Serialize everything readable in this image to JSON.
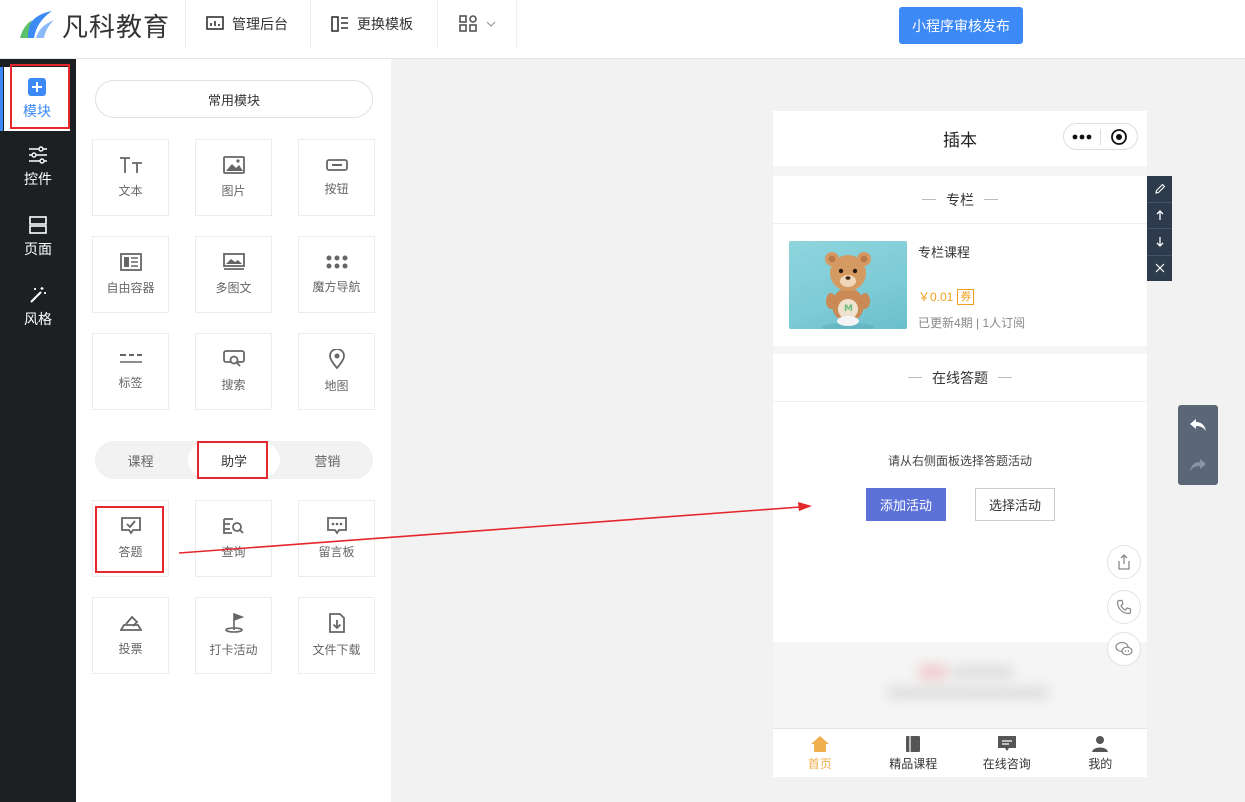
{
  "app": {
    "logo_text": "凡科教育",
    "nav": {
      "admin": "管理后台",
      "template": "更换模板"
    },
    "publish_button": "小程序审核发布"
  },
  "sidebar": {
    "items": [
      {
        "label": "模块",
        "icon": "plus-square-icon"
      },
      {
        "label": "控件",
        "icon": "sliders-icon"
      },
      {
        "label": "页面",
        "icon": "layout-icon"
      },
      {
        "label": "风格",
        "icon": "magic-wand-icon"
      }
    ]
  },
  "panel": {
    "common_title": "常用模块",
    "common_modules": [
      {
        "label": "文本",
        "icon": "text-icon"
      },
      {
        "label": "图片",
        "icon": "image-icon"
      },
      {
        "label": "按钮",
        "icon": "button-icon"
      },
      {
        "label": "自由容器",
        "icon": "container-icon"
      },
      {
        "label": "多图文",
        "icon": "multi-image-icon"
      },
      {
        "label": "魔方导航",
        "icon": "grid-dots-icon"
      },
      {
        "label": "标签",
        "icon": "tabs-icon"
      },
      {
        "label": "搜索",
        "icon": "search-icon"
      },
      {
        "label": "地图",
        "icon": "map-pin-icon"
      }
    ],
    "tabs": [
      "课程",
      "助学",
      "营销"
    ],
    "study_modules": [
      {
        "label": "答题",
        "icon": "quiz-icon"
      },
      {
        "label": "查询",
        "icon": "query-icon"
      },
      {
        "label": "留言板",
        "icon": "message-board-icon"
      },
      {
        "label": "投票",
        "icon": "vote-icon"
      },
      {
        "label": "打卡活动",
        "icon": "checkin-flag-icon"
      },
      {
        "label": "文件下载",
        "icon": "file-download-icon"
      }
    ]
  },
  "phone": {
    "title": "插本",
    "column_section": {
      "heading": "专栏",
      "course_name": "专栏课程",
      "price": "￥0.01",
      "coupon": "券",
      "meta": "已更新4期 | 1人订阅"
    },
    "quiz_section": {
      "heading": "在线答题",
      "hint": "请从右侧面板选择答题活动",
      "add_button": "添加活动",
      "select_button": "选择活动"
    },
    "tabbar": [
      {
        "label": "首页",
        "icon": "home-icon"
      },
      {
        "label": "精品课程",
        "icon": "book-icon"
      },
      {
        "label": "在线咨询",
        "icon": "chat-icon"
      },
      {
        "label": "我的",
        "icon": "user-icon"
      }
    ]
  },
  "colors": {
    "accent": "#3d8af7",
    "dark_sidebar": "#1d2023",
    "add_button": "#5d72d9",
    "annotation_red": "#e5262a",
    "tabbar_active": "#f0b050"
  }
}
